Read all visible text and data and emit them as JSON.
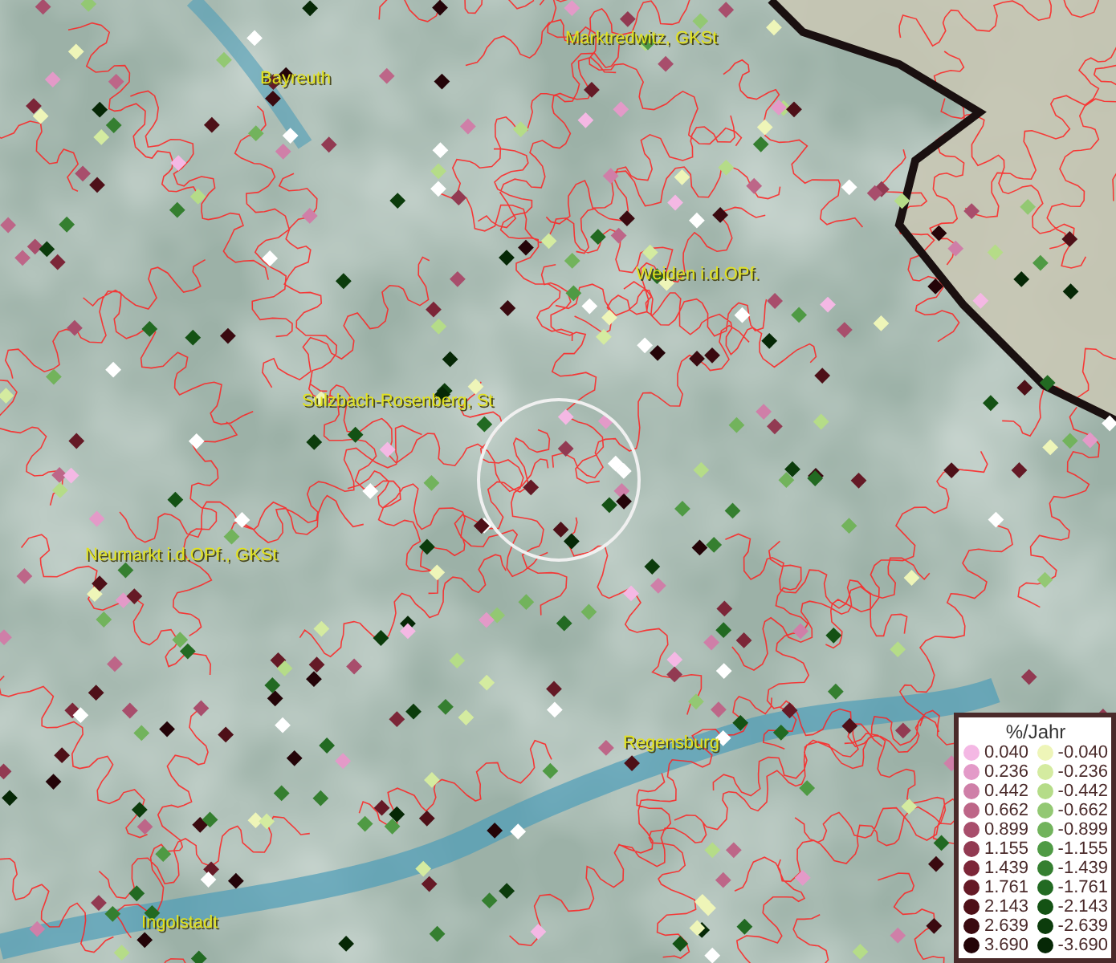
{
  "map": {
    "place_labels": [
      {
        "name": "Marktredwitz, GKSt"
      },
      {
        "name": "Bayreuth"
      },
      {
        "name": "Weiden i.d.OPf."
      },
      {
        "name": "Sulzbach-Rosenberg, St"
      },
      {
        "name": "Neumarkt i.d.OPf., GKSt"
      },
      {
        "name": "Regensburg"
      },
      {
        "name": "Ingolstadt"
      }
    ]
  },
  "legend": {
    "title": "%/Jahr",
    "increase": [
      {
        "value": "0.040",
        "color": "#f4b8e4"
      },
      {
        "value": "0.236",
        "color": "#e39ac8"
      },
      {
        "value": "0.442",
        "color": "#cf7fa8"
      },
      {
        "value": "0.662",
        "color": "#bd6688"
      },
      {
        "value": "0.899",
        "color": "#a84e6c"
      },
      {
        "value": "1.155",
        "color": "#923a52"
      },
      {
        "value": "1.439",
        "color": "#7c2638"
      },
      {
        "value": "1.761",
        "color": "#651a26"
      },
      {
        "value": "2.143",
        "color": "#4e1018"
      },
      {
        "value": "2.639",
        "color": "#3a0a10"
      },
      {
        "value": "3.690",
        "color": "#240408"
      }
    ],
    "decrease": [
      {
        "value": "-0.040",
        "color": "#eef5b8"
      },
      {
        "value": "-0.236",
        "color": "#d4eba0"
      },
      {
        "value": "-0.442",
        "color": "#b5dc88"
      },
      {
        "value": "-0.662",
        "color": "#93c873"
      },
      {
        "value": "-0.899",
        "color": "#72b35c"
      },
      {
        "value": "-1.155",
        "color": "#4f9a44"
      },
      {
        "value": "-1.439",
        "color": "#357f30"
      },
      {
        "value": "-1.761",
        "color": "#226a22"
      },
      {
        "value": "-2.143",
        "color": "#145214"
      },
      {
        "value": "-2.639",
        "color": "#0c3c0c"
      },
      {
        "value": "-3.690",
        "color": "#062806"
      }
    ]
  }
}
